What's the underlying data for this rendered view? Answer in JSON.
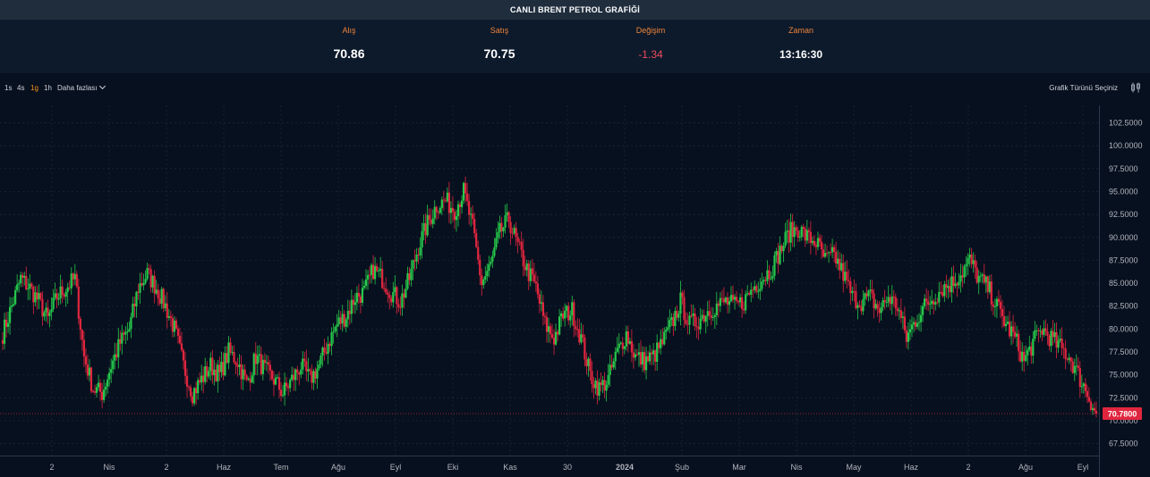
{
  "header": {
    "title": "CANLI BRENT PETROL GRAFİĞİ"
  },
  "quote": {
    "bid_label": "Alış",
    "bid_value": "70.86",
    "ask_label": "Satış",
    "ask_value": "70.75",
    "change_label": "Değişim",
    "change_value": "-1.34",
    "time_label": "Zaman",
    "time_value": "13:16:30"
  },
  "toolbar": {
    "timeframes": [
      "1s",
      "4s",
      "1g",
      "1h"
    ],
    "active_timeframe": "1g",
    "more_label": "Daha fazlası",
    "chart_type_label": "Grafik Türünü Seçiniz",
    "chart_type_icon": "candles-icon"
  },
  "colors": {
    "up": "#26c94b",
    "down": "#e0263f",
    "price_line": "#e0263f",
    "background": "#07101e",
    "grid": "#1c2b3c"
  },
  "chart_data": {
    "type": "candlestick",
    "ylim": [
      66.2,
      104.4
    ],
    "y_ticks": [
      "102.5000",
      "100.0000",
      "97.5000",
      "95.0000",
      "92.5000",
      "90.0000",
      "87.5000",
      "85.0000",
      "82.5000",
      "80.0000",
      "77.5000",
      "75.0000",
      "72.5000",
      "70.0000",
      "67.5000"
    ],
    "x_ticks": [
      "2",
      "Nis",
      "2",
      "Haz",
      "Tem",
      "Ağu",
      "Eyl",
      "Eki",
      "Kas",
      "30",
      "2024",
      "Şub",
      "Mar",
      "Nis",
      "May",
      "Haz",
      "2",
      "Ağu",
      "Eyl"
    ],
    "last_price": 70.78,
    "last_price_label": "70.7800",
    "closes": [
      79.5,
      82.5,
      85.5,
      84.5,
      83.0,
      81.0,
      83.5,
      84.5,
      85.5,
      77.0,
      73.5,
      73.0,
      76.0,
      78.5,
      80.0,
      84.5,
      86.0,
      84.5,
      82.5,
      80.0,
      76.0,
      73.0,
      74.5,
      76.0,
      75.0,
      77.5,
      76.5,
      74.0,
      77.0,
      75.5,
      74.5,
      73.0,
      74.5,
      76.0,
      74.5,
      76.0,
      78.5,
      80.5,
      81.5,
      83.5,
      84.0,
      86.5,
      85.5,
      84.0,
      83.0,
      85.5,
      89.0,
      91.5,
      93.5,
      94.0,
      93.0,
      95.0,
      91.0,
      85.0,
      87.0,
      90.5,
      92.0,
      89.0,
      86.5,
      84.5,
      80.5,
      79.0,
      81.5,
      82.0,
      79.0,
      75.0,
      73.5,
      74.5,
      77.5,
      79.5,
      77.0,
      76.5,
      77.0,
      78.5,
      80.5,
      83.0,
      80.5,
      81.0,
      82.0,
      82.5,
      83.0,
      82.5,
      83.0,
      84.5,
      85.5,
      86.5,
      88.5,
      90.5,
      91.0,
      90.0,
      89.5,
      87.5,
      88.0,
      86.0,
      83.5,
      83.0,
      83.5,
      82.0,
      83.5,
      82.5,
      79.0,
      81.0,
      82.5,
      83.5,
      84.5,
      85.0,
      86.0,
      87.5,
      85.5,
      84.5,
      82.5,
      80.5,
      79.0,
      76.5,
      78.5,
      80.0,
      79.0,
      78.0,
      77.0,
      75.0,
      73.0,
      70.78
    ]
  }
}
